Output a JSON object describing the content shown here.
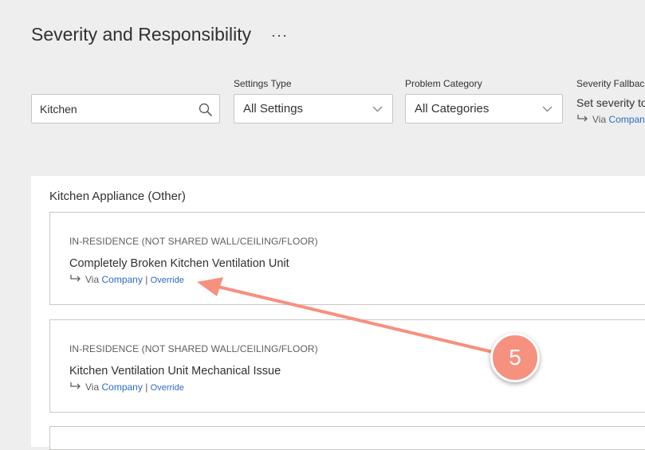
{
  "page": {
    "title": "Severity and Responsibility",
    "more_label": "···"
  },
  "filters": {
    "search": {
      "value": "Kitchen",
      "icon": "search-icon"
    },
    "settings_type": {
      "label": "Settings Type",
      "selected": "All Settings"
    },
    "problem_category": {
      "label": "Problem Category",
      "selected": "All Categories"
    },
    "severity_fallback": {
      "label": "Severity Fallback",
      "text": "Set severity to",
      "via_prefix": "Via",
      "via_link": "Company"
    }
  },
  "group": {
    "title": "Kitchen Appliance (Other)",
    "items": [
      {
        "category": "IN-RESIDENCE (NOT SHARED WALL/CEILING/FLOOR)",
        "name": "Completely Broken Kitchen Ventilation Unit",
        "via_prefix": "Via",
        "via_link": "Company",
        "separator": "|",
        "override": "Override"
      },
      {
        "category": "IN-RESIDENCE (NOT SHARED WALL/CEILING/FLOOR)",
        "name": "Kitchen Ventilation Unit Mechanical Issue",
        "via_prefix": "Via",
        "via_link": "Company",
        "separator": "|",
        "override": "Override"
      }
    ]
  },
  "annotation": {
    "number": "5",
    "color": "#f6907f"
  }
}
